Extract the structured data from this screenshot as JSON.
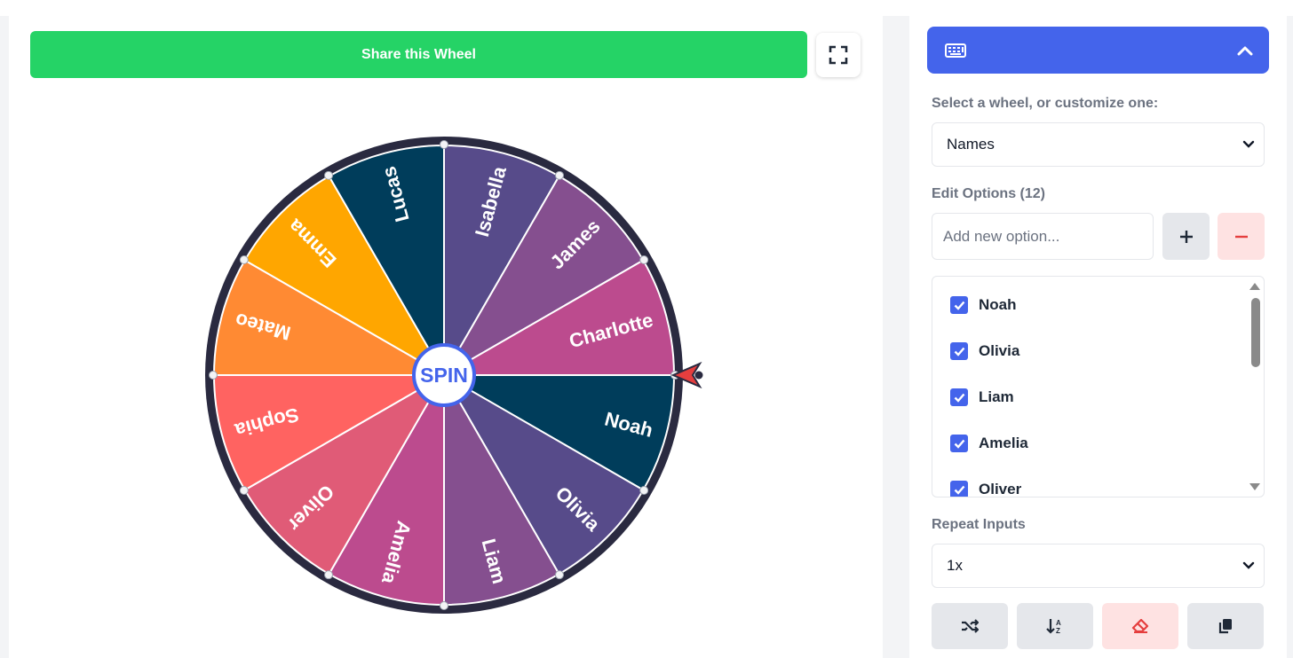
{
  "share_button": {
    "label": "Share this Wheel"
  },
  "fullscreen_button": {
    "icon": "fullscreen-icon"
  },
  "wheel": {
    "spin_label": "SPIN",
    "segments": [
      {
        "label": "Noah",
        "color": "#003d5b"
      },
      {
        "label": "Olivia",
        "color": "#574b8a"
      },
      {
        "label": "Liam",
        "color": "#854f8f"
      },
      {
        "label": "Amelia",
        "color": "#bc4b8e"
      },
      {
        "label": "Oliver",
        "color": "#e05b77"
      },
      {
        "label": "Sophia",
        "color": "#ff6361"
      },
      {
        "label": "Mateo",
        "color": "#ff8a33"
      },
      {
        "label": "Emma",
        "color": "#ffa600"
      },
      {
        "label": "Lucas",
        "color": "#003d5b"
      },
      {
        "label": "Isabella",
        "color": "#574b8a"
      },
      {
        "label": "James",
        "color": "#854f8f"
      },
      {
        "label": "Charlotte",
        "color": "#bc4b8e"
      }
    ],
    "rim_color": "#2a2a40",
    "pointer_color": "#e53e3e"
  },
  "sidebar": {
    "header_icon": "keyboard-icon",
    "collapse_icon": "chevron-up-icon",
    "select_wheel_label": "Select a wheel, or customize one:",
    "wheel_select_value": "Names",
    "edit_options_label": "Edit Options (12)",
    "add_option_placeholder": "Add new option...",
    "options": [
      "Noah",
      "Olivia",
      "Liam",
      "Amelia",
      "Oliver"
    ],
    "repeat_label": "Repeat Inputs",
    "repeat_value": "1x",
    "tools": [
      "shuffle-icon",
      "sort-alpha-icon",
      "eraser-icon",
      "copy-icon"
    ]
  },
  "colors": {
    "accent": "#4464eb",
    "share_green": "#25d366",
    "danger_bg": "#fee2e2",
    "danger": "#e53e3e"
  }
}
